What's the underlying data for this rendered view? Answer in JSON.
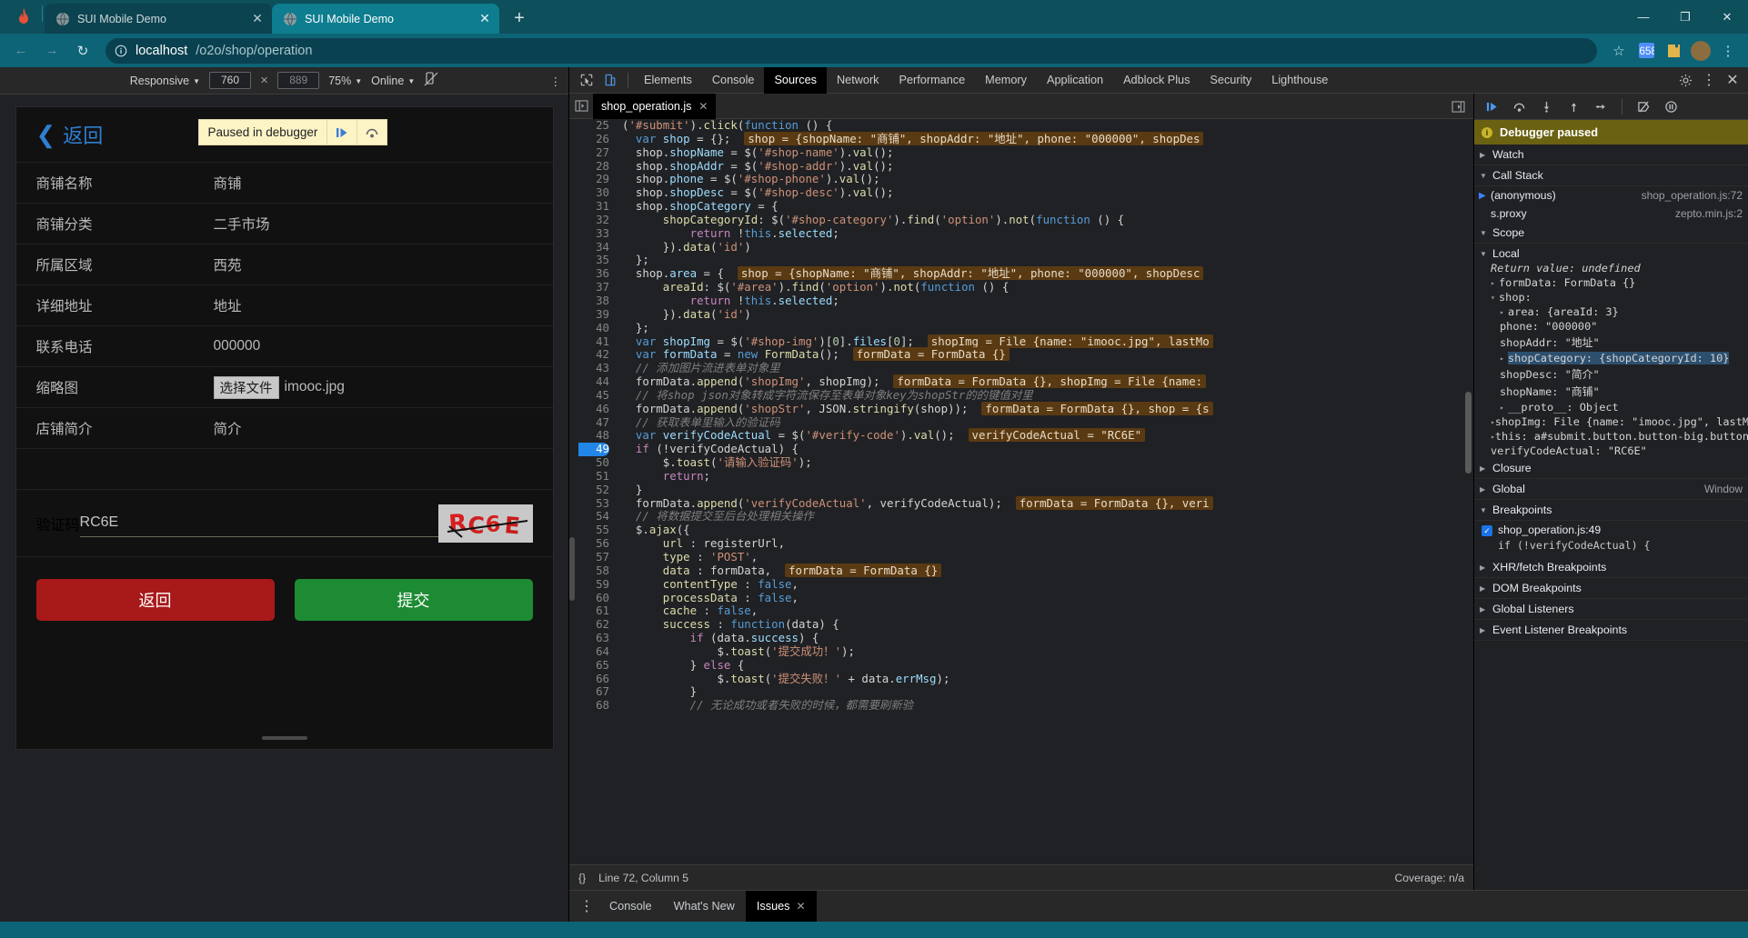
{
  "browser": {
    "tabs": [
      {
        "title": "SUI Mobile Demo",
        "active": false
      },
      {
        "title": "SUI Mobile Demo",
        "active": true
      }
    ],
    "new_tab_label": "+",
    "window_controls": {
      "minimize": "—",
      "maximize": "❐",
      "close": "✕"
    },
    "nav": {
      "back": "←",
      "forward": "→",
      "reload": "↻"
    },
    "omnibox": {
      "host": "localhost",
      "path": "/o2o/shop/operation",
      "info_icon": "info-icon",
      "star": "☆"
    }
  },
  "device_toolbar": {
    "device": "Responsive",
    "width": "760",
    "height": "889",
    "height_placeholder": "889",
    "zoom": "75%",
    "throttling": "Online",
    "rotate_icon": "rotate-icon",
    "kebab": "⋮"
  },
  "phone": {
    "back_label": "返回",
    "paused_banner": {
      "text": "Paused in debugger",
      "resume_icon": "resume-icon",
      "step-over_icon": "step-over-icon"
    },
    "fields": [
      {
        "label": "商铺名称",
        "value": "商铺"
      },
      {
        "label": "商铺分类",
        "value": "二手市场"
      },
      {
        "label": "所属区域",
        "value": "西苑"
      },
      {
        "label": "详细地址",
        "value": "地址"
      },
      {
        "label": "联系电话",
        "value": "000000"
      }
    ],
    "thumbnail": {
      "label": "缩略图",
      "button": "选择文件",
      "filename": "imooc.jpg"
    },
    "desc": {
      "label": "店铺简介",
      "value": "简介"
    },
    "verify": {
      "label": "验证码",
      "value": "RC6E",
      "captcha_text": "RC6E"
    },
    "buttons": {
      "back": "返回",
      "submit": "提交"
    }
  },
  "devtools": {
    "inspect_icon": "inspect-icon",
    "device_icon": "device-toolbar-icon",
    "tabs": [
      {
        "label": "Elements",
        "active": false
      },
      {
        "label": "Console",
        "active": false
      },
      {
        "label": "Sources",
        "active": true
      },
      {
        "label": "Network",
        "active": false
      },
      {
        "label": "Performance",
        "active": false
      },
      {
        "label": "Memory",
        "active": false
      },
      {
        "label": "Application",
        "active": false
      },
      {
        "label": "Adblock Plus",
        "active": false
      },
      {
        "label": "Security",
        "active": false
      },
      {
        "label": "Lighthouse",
        "active": false
      }
    ],
    "settings_icon": "gear-icon",
    "more_icon": "kebab-icon",
    "close_icon": "close-icon",
    "file_tab": {
      "name": "shop_operation.js",
      "close": "✕"
    },
    "status": {
      "position": "Line 72, Column 5",
      "coverage": "Coverage: n/a",
      "format_icon": "format-braces-icon"
    },
    "debugger": {
      "toolbar_icons": [
        "resume-icon",
        "step-over-icon",
        "step-into-icon",
        "step-out-icon",
        "step-icon",
        "deactivate-breakpoints-icon",
        "pause-on-exceptions-icon"
      ],
      "paused_text": "Debugger paused",
      "sections": {
        "watch": "Watch",
        "call_stack": "Call Stack",
        "scope": "Scope",
        "breakpoints": "Breakpoints",
        "xhr": "XHR/fetch Breakpoints",
        "dom": "DOM Breakpoints",
        "global_listeners": "Global Listeners",
        "event_listener": "Event Listener Breakpoints"
      },
      "call_stack": [
        {
          "name": "(anonymous)",
          "location": "shop_operation.js:72",
          "current": true
        },
        {
          "name": "s.proxy",
          "location": "zepto.min.js:2",
          "current": false
        }
      ],
      "scope_label": "Local",
      "scope_lines": [
        {
          "indent": 1,
          "text": "Return value: undefined",
          "kind": "return"
        },
        {
          "indent": 1,
          "text": "formData: FormData {}",
          "kind": "obj",
          "tri": "▸"
        },
        {
          "indent": 1,
          "text": "shop:",
          "kind": "obj",
          "tri": "▾"
        },
        {
          "indent": 2,
          "text": "area: {areaId: 3}",
          "kind": "obj",
          "tri": "▸"
        },
        {
          "indent": 2,
          "text": "phone: \"000000\"",
          "kind": "str"
        },
        {
          "indent": 2,
          "text": "shopAddr: \"地址\"",
          "kind": "str"
        },
        {
          "indent": 2,
          "text": "shopCategory: {shopCategoryId: 10}",
          "kind": "sel",
          "tri": "▸"
        },
        {
          "indent": 2,
          "text": "shopDesc: \"简介\"",
          "kind": "str"
        },
        {
          "indent": 2,
          "text": "shopName: \"商铺\"",
          "kind": "str"
        },
        {
          "indent": 2,
          "text": "__proto__: Object",
          "kind": "obj",
          "tri": "▸"
        },
        {
          "indent": 1,
          "text": "shopImg: File {name: \"imooc.jpg\", lastMo",
          "kind": "obj",
          "tri": "▸"
        },
        {
          "indent": 1,
          "text": "this: a#submit.button.button-big.button-f",
          "kind": "obj",
          "tri": "▸"
        },
        {
          "indent": 1,
          "text": "verifyCodeActual: \"RC6E\"",
          "kind": "str"
        }
      ],
      "closure": "Closure",
      "global": "Global",
      "global_value": "Window",
      "breakpoint": {
        "file": "shop_operation.js:49",
        "code": "if (!verifyCodeActual) {",
        "checked": true
      }
    },
    "drawer": {
      "kebab": "⋮",
      "tabs": [
        {
          "label": "Console",
          "active": false,
          "closable": false
        },
        {
          "label": "What's New",
          "active": false,
          "closable": false
        },
        {
          "label": "Issues",
          "active": true,
          "closable": true
        }
      ]
    }
  },
  "code": {
    "lines": [
      {
        "n": "25",
        "html": "<span class=\"pl\">(</span><span class=\"str\">'#submit'</span><span class=\"pl\">).</span><span class=\"fn\">click</span><span class=\"pl\">(</span><span class=\"kw\">function</span> <span class=\"pl\">() {</span>"
      },
      {
        "n": "26",
        "html": "  <span class=\"kw\">var</span> <span class=\"prop\">shop</span> <span class=\"pl\">= {};</span>  <span class=\"inline-val\">shop = {shopName: \"商铺\", shopAddr: \"地址\", phone: \"000000\", shopDes</span>"
      },
      {
        "n": "27",
        "html": "  <span class=\"pl\">shop.</span><span class=\"prop\">shopName</span> <span class=\"pl\">= </span><span class=\"dollar\">$</span><span class=\"pl\">(</span><span class=\"str\">'#shop-name'</span><span class=\"pl\">).</span><span class=\"fn\">val</span><span class=\"pl\">();</span>"
      },
      {
        "n": "28",
        "html": "  <span class=\"pl\">shop.</span><span class=\"prop\">shopAddr</span> <span class=\"pl\">= </span><span class=\"dollar\">$</span><span class=\"pl\">(</span><span class=\"str\">'#shop-addr'</span><span class=\"pl\">).</span><span class=\"fn\">val</span><span class=\"pl\">();</span>"
      },
      {
        "n": "29",
        "html": "  <span class=\"pl\">shop.</span><span class=\"prop\">phone</span> <span class=\"pl\">= </span><span class=\"dollar\">$</span><span class=\"pl\">(</span><span class=\"str\">'#shop-phone'</span><span class=\"pl\">).</span><span class=\"fn\">val</span><span class=\"pl\">();</span>"
      },
      {
        "n": "30",
        "html": "  <span class=\"pl\">shop.</span><span class=\"prop\">shopDesc</span> <span class=\"pl\">= </span><span class=\"dollar\">$</span><span class=\"pl\">(</span><span class=\"str\">'#shop-desc'</span><span class=\"pl\">).</span><span class=\"fn\">val</span><span class=\"pl\">();</span>"
      },
      {
        "n": "31",
        "html": "  <span class=\"pl\">shop.</span><span class=\"prop\">shopCategory</span> <span class=\"pl\">= {</span>"
      },
      {
        "n": "32",
        "html": "      <span class=\"fn\">shopCategoryId</span><span class=\"pl\">: </span><span class=\"dollar\">$</span><span class=\"pl\">(</span><span class=\"str\">'#shop-category'</span><span class=\"pl\">).</span><span class=\"fn\">find</span><span class=\"pl\">(</span><span class=\"str\">'option'</span><span class=\"pl\">).</span><span class=\"fn\">not</span><span class=\"pl\">(</span><span class=\"kw\">function</span> <span class=\"pl\">() {</span>"
      },
      {
        "n": "33",
        "html": "          <span class=\"k\">return</span> <span class=\"pl\">!</span><span class=\"kw\">this</span><span class=\"pl\">.</span><span class=\"prop\">selected</span><span class=\"pl\">;</span>"
      },
      {
        "n": "34",
        "html": "      <span class=\"pl\">}).</span><span class=\"fn\">data</span><span class=\"pl\">(</span><span class=\"str\">'id'</span><span class=\"pl\">)</span>"
      },
      {
        "n": "35",
        "html": "  <span class=\"pl\">};</span>"
      },
      {
        "n": "36",
        "html": "  <span class=\"pl\">shop.</span><span class=\"prop\">area</span> <span class=\"pl\">= {</span>  <span class=\"inline-val\">shop = {shopName: \"商铺\", shopAddr: \"地址\", phone: \"000000\", shopDesc</span>"
      },
      {
        "n": "37",
        "html": "      <span class=\"fn\">areaId</span><span class=\"pl\">: </span><span class=\"dollar\">$</span><span class=\"pl\">(</span><span class=\"str\">'#area'</span><span class=\"pl\">).</span><span class=\"fn\">find</span><span class=\"pl\">(</span><span class=\"str\">'option'</span><span class=\"pl\">).</span><span class=\"fn\">not</span><span class=\"pl\">(</span><span class=\"kw\">function</span> <span class=\"pl\">() {</span>"
      },
      {
        "n": "38",
        "html": "          <span class=\"k\">return</span> <span class=\"pl\">!</span><span class=\"kw\">this</span><span class=\"pl\">.</span><span class=\"prop\">selected</span><span class=\"pl\">;</span>"
      },
      {
        "n": "39",
        "html": "      <span class=\"pl\">}).</span><span class=\"fn\">data</span><span class=\"pl\">(</span><span class=\"str\">'id'</span><span class=\"pl\">)</span>"
      },
      {
        "n": "40",
        "html": "  <span class=\"pl\">};</span>"
      },
      {
        "n": "41",
        "html": "  <span class=\"kw\">var</span> <span class=\"prop\">shopImg</span> <span class=\"pl\">= </span><span class=\"dollar\">$</span><span class=\"pl\">(</span><span class=\"str\">'#shop-img'</span><span class=\"pl\">)[</span><span class=\"num\">0</span><span class=\"pl\">].</span><span class=\"prop\">files</span><span class=\"pl\">[</span><span class=\"num\">0</span><span class=\"pl\">];</span>  <span class=\"inline-val\">shopImg = File {name: \"imooc.jpg\", lastMo</span>"
      },
      {
        "n": "42",
        "html": "  <span class=\"kw\">var</span> <span class=\"prop\">formData</span> <span class=\"pl\">= </span><span class=\"kw\">new</span> <span class=\"fn\">FormData</span><span class=\"pl\">();</span>  <span class=\"inline-val\">formData = FormData {}</span>"
      },
      {
        "n": "43",
        "html": "  <span class=\"com\">// 添加图片流进表单对象里</span>"
      },
      {
        "n": "44",
        "html": "  <span class=\"pl\">formData.</span><span class=\"fn\">append</span><span class=\"pl\">(</span><span class=\"str\">'shopImg'</span><span class=\"pl\">, shopImg);</span>  <span class=\"inline-val\">formData = FormData {}, shopImg = File {name:</span>"
      },
      {
        "n": "45",
        "html": "  <span class=\"com\">// 将shop json对象转成字符流保存至表单对象key为shopStr的的键值对里</span>"
      },
      {
        "n": "46",
        "html": "  <span class=\"pl\">formData.</span><span class=\"fn\">append</span><span class=\"pl\">(</span><span class=\"str\">'shopStr'</span><span class=\"pl\">, JSON.</span><span class=\"fn\">stringify</span><span class=\"pl\">(shop));</span>  <span class=\"inline-val\">formData = FormData {}, shop = {s</span>"
      },
      {
        "n": "47",
        "html": "  <span class=\"com\">// 获取表单里输入的验证码</span>"
      },
      {
        "n": "48",
        "html": "  <span class=\"kw\">var</span> <span class=\"prop\">verifyCodeActual</span> <span class=\"pl\">= </span><span class=\"dollar\">$</span><span class=\"pl\">(</span><span class=\"str\">'#verify-code'</span><span class=\"pl\">).</span><span class=\"fn\">val</span><span class=\"pl\">();</span>  <span class=\"inline-val\">verifyCodeActual = \"RC6E\"</span>"
      },
      {
        "n": "49",
        "hl": true,
        "html": "  <span class=\"k\">if</span> <span class=\"pl\">(!verifyCodeActual) {</span>"
      },
      {
        "n": "50",
        "html": "      <span class=\"dollar\">$</span><span class=\"pl\">.</span><span class=\"fn\">toast</span><span class=\"pl\">(</span><span class=\"str\">'请输入验证码'</span><span class=\"pl\">);</span>"
      },
      {
        "n": "51",
        "html": "      <span class=\"k\">return</span><span class=\"pl\">;</span>"
      },
      {
        "n": "52",
        "html": "  <span class=\"pl\">}</span>"
      },
      {
        "n": "53",
        "html": "  <span class=\"pl\">formData.</span><span class=\"fn\">append</span><span class=\"pl\">(</span><span class=\"str\">'verifyCodeActual'</span><span class=\"pl\">, verifyCodeActual);</span>  <span class=\"inline-val\">formData = FormData {}, veri</span>"
      },
      {
        "n": "54",
        "html": "  <span class=\"com\">// 将数据提交至后台处理相关操作</span>"
      },
      {
        "n": "55",
        "html": "  <span class=\"dollar\">$</span><span class=\"pl\">.</span><span class=\"fn\">ajax</span><span class=\"pl\">({</span>"
      },
      {
        "n": "56",
        "html": "      <span class=\"fn\">url</span> <span class=\"pl\">: registerUrl,</span>"
      },
      {
        "n": "57",
        "html": "      <span class=\"fn\">type</span> <span class=\"pl\">: </span><span class=\"str\">'POST'</span><span class=\"pl\">,</span>"
      },
      {
        "n": "58",
        "html": "      <span class=\"fn\">data</span> <span class=\"pl\">: formData,</span>  <span class=\"inline-val\">formData = FormData {}</span>"
      },
      {
        "n": "59",
        "html": "      <span class=\"fn\">contentType</span> <span class=\"pl\">: </span><span class=\"kw\">false</span><span class=\"pl\">,</span>"
      },
      {
        "n": "60",
        "html": "      <span class=\"fn\">processData</span> <span class=\"pl\">: </span><span class=\"kw\">false</span><span class=\"pl\">,</span>"
      },
      {
        "n": "61",
        "html": "      <span class=\"fn\">cache</span> <span class=\"pl\">: </span><span class=\"kw\">false</span><span class=\"pl\">,</span>"
      },
      {
        "n": "62",
        "html": "      <span class=\"fn\">success</span> <span class=\"pl\">: </span><span class=\"kw\">function</span><span class=\"pl\">(data) {</span>"
      },
      {
        "n": "63",
        "html": "          <span class=\"k\">if</span> <span class=\"pl\">(data.</span><span class=\"prop\">success</span><span class=\"pl\">) {</span>"
      },
      {
        "n": "64",
        "html": "              <span class=\"dollar\">$</span><span class=\"pl\">.</span><span class=\"fn\">toast</span><span class=\"pl\">(</span><span class=\"str\">'提交成功！'</span><span class=\"pl\">);</span>"
      },
      {
        "n": "65",
        "html": "          <span class=\"pl\">} </span><span class=\"k\">else</span> <span class=\"pl\">{</span>"
      },
      {
        "n": "66",
        "html": "              <span class=\"dollar\">$</span><span class=\"pl\">.</span><span class=\"fn\">toast</span><span class=\"pl\">(</span><span class=\"str\">'提交失败！'</span><span class=\"pl\"> + data.</span><span class=\"prop\">errMsg</span><span class=\"pl\">);</span>"
      },
      {
        "n": "67",
        "html": "          <span class=\"pl\">}</span>"
      },
      {
        "n": "68",
        "html": "          <span class=\"com\">// 无论成功或者失败的时候，都需要刷新验</span>"
      }
    ]
  }
}
